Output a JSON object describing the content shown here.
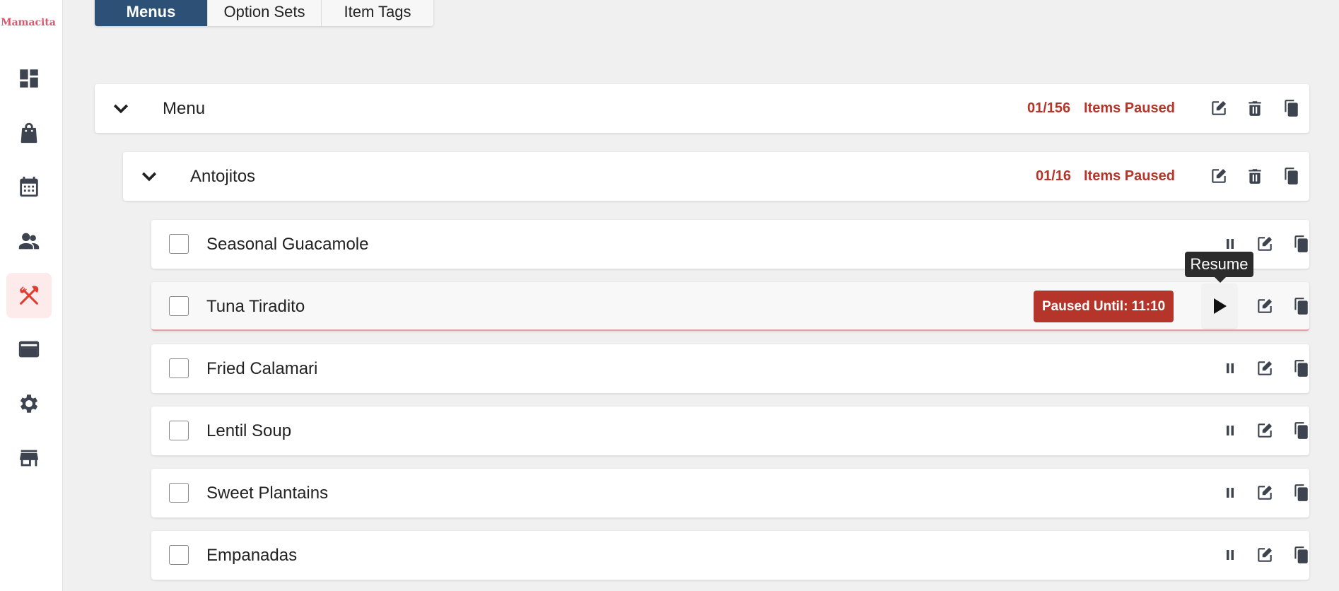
{
  "app": {
    "brand": "Mamacita"
  },
  "sidebar": {
    "items": [
      {
        "name": "dashboard",
        "icon": "dashboard-icon",
        "active": false
      },
      {
        "name": "orders",
        "icon": "shopping-bag-icon",
        "active": false
      },
      {
        "name": "calendar",
        "icon": "calendar-icon",
        "active": false
      },
      {
        "name": "customers",
        "icon": "people-icon",
        "active": false
      },
      {
        "name": "menus",
        "icon": "utensils-icon",
        "active": true
      },
      {
        "name": "payments",
        "icon": "credit-card-icon",
        "active": false
      },
      {
        "name": "settings",
        "icon": "gear-icon",
        "active": false
      },
      {
        "name": "store",
        "icon": "storefront-icon",
        "active": false
      }
    ]
  },
  "tabs": [
    {
      "label": "Menus",
      "active": true
    },
    {
      "label": "Option Sets",
      "active": false
    },
    {
      "label": "Item Tags",
      "active": false
    }
  ],
  "menu": {
    "title": "Menu",
    "paused_count": "01/156",
    "paused_label": "Items Paused"
  },
  "category": {
    "title": "Antojitos",
    "paused_count": "01/16",
    "paused_label": "Items Paused"
  },
  "items": [
    {
      "name": "Seasonal Guacamole",
      "paused": false
    },
    {
      "name": "Tuna Tiradito",
      "paused": true,
      "badge": "Paused Until: 11:10"
    },
    {
      "name": "Fried Calamari",
      "paused": false
    },
    {
      "name": "Lentil Soup",
      "paused": false
    },
    {
      "name": "Sweet Plantains",
      "paused": false
    },
    {
      "name": "Empanadas",
      "paused": false
    }
  ],
  "tooltip": {
    "text": "Resume"
  },
  "colors": {
    "accent_navy": "#2c5076",
    "paused_red": "#b5352b",
    "brand_pink": "#e0546e",
    "active_nav_red": "#e03c31",
    "icon_gray": "#3d4450"
  }
}
